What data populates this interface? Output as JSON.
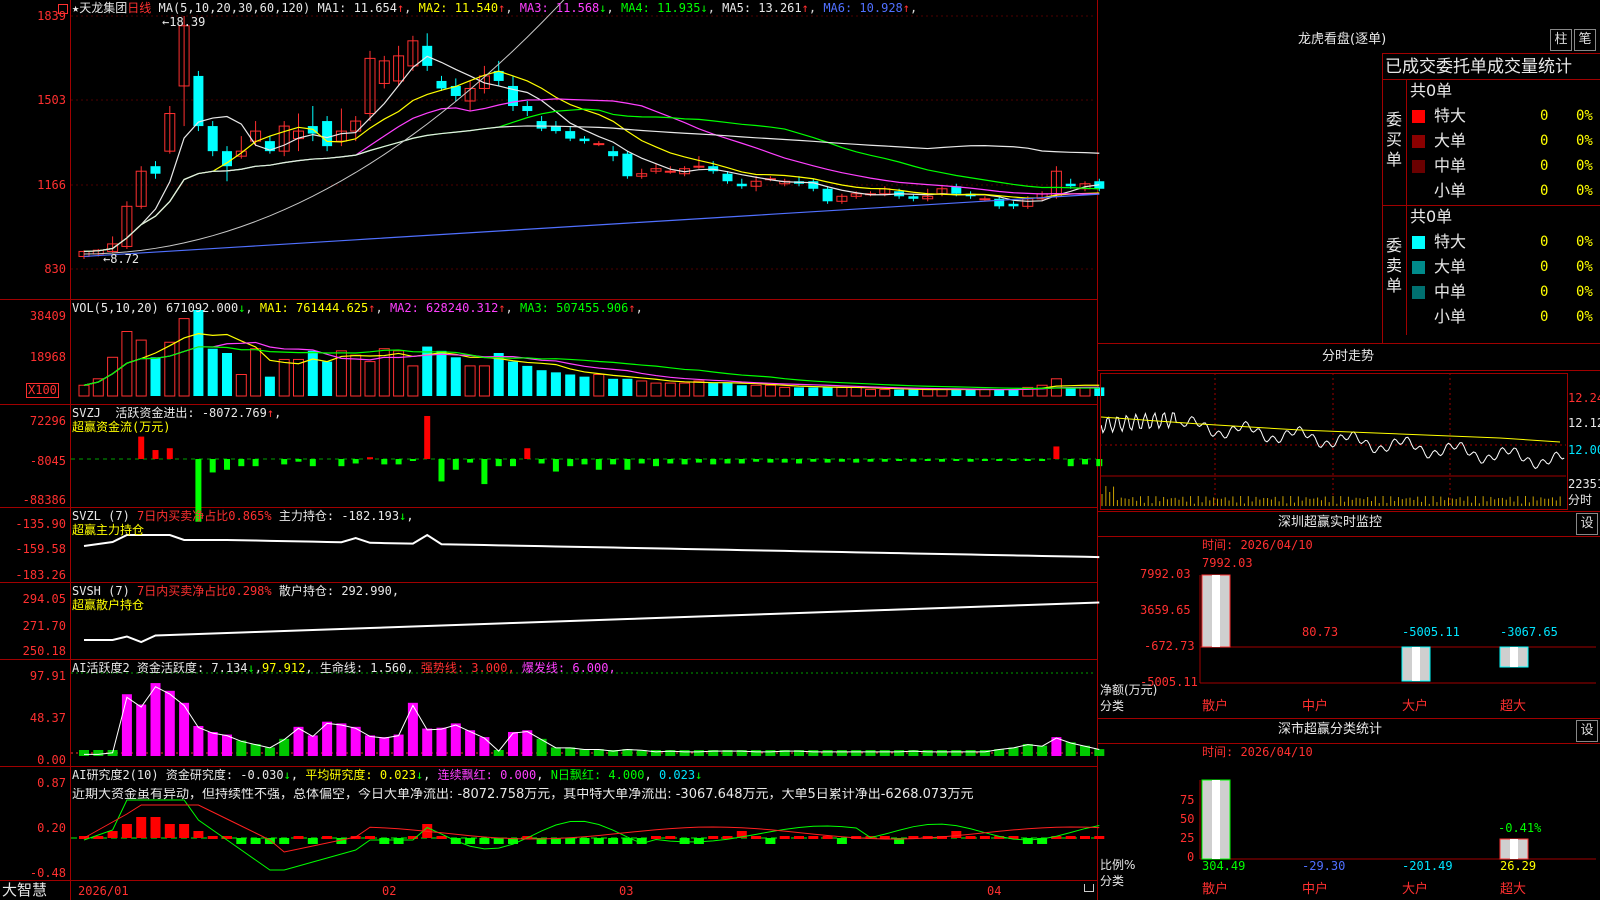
{
  "chart_data": {
    "type": "candlestick",
    "stock_name": "天龙集团",
    "period": "日线",
    "x_ticks": [
      "2026/01",
      "02",
      "03",
      "04"
    ],
    "price": {
      "axis": [
        "1839",
        "1503",
        "1166",
        "830"
      ],
      "ylim": [
        830,
        1839
      ],
      "max_label": "18.39",
      "min_label": "8.72",
      "ma_header": "MA(5,10,20,30,60,120)",
      "ma": [
        {
          "name": "MA1",
          "value": "11.654",
          "arrow": "↑",
          "color": "#e8e8e8"
        },
        {
          "name": "MA2",
          "value": "11.540",
          "arrow": "↑",
          "color": "#ffff00"
        },
        {
          "name": "MA3",
          "value": "11.568",
          "arrow": "↓",
          "color": "#ff40ff"
        },
        {
          "name": "MA4",
          "value": "11.935",
          "arrow": "↓",
          "color": "#00ff00"
        },
        {
          "name": "MA5",
          "value": "13.261",
          "arrow": "↑",
          "color": "#e8e8e8"
        },
        {
          "name": "MA6",
          "value": "10.928",
          "arrow": "↑",
          "color": "#5070ff"
        }
      ],
      "candles": [
        [
          880,
          900,
          870,
          905
        ],
        [
          890,
          905,
          880,
          910
        ],
        [
          900,
          930,
          895,
          960
        ],
        [
          920,
          1080,
          910,
          1100
        ],
        [
          1080,
          1220,
          1070,
          1240
        ],
        [
          1240,
          1210,
          1190,
          1260
        ],
        [
          1300,
          1450,
          1290,
          1480
        ],
        [
          1560,
          1800,
          1400,
          1839
        ],
        [
          1600,
          1400,
          1380,
          1620
        ],
        [
          1400,
          1300,
          1280,
          1420
        ],
        [
          1300,
          1240,
          1180,
          1320
        ],
        [
          1280,
          1300,
          1270,
          1360
        ],
        [
          1340,
          1380,
          1320,
          1420
        ],
        [
          1340,
          1300,
          1290,
          1360
        ],
        [
          1300,
          1400,
          1280,
          1420
        ],
        [
          1350,
          1380,
          1300,
          1450
        ],
        [
          1400,
          1370,
          1340,
          1480
        ],
        [
          1420,
          1320,
          1300,
          1440
        ],
        [
          1340,
          1380,
          1320,
          1470
        ],
        [
          1380,
          1420,
          1340,
          1440
        ],
        [
          1450,
          1670,
          1420,
          1700
        ],
        [
          1570,
          1660,
          1550,
          1680
        ],
        [
          1580,
          1680,
          1560,
          1720
        ],
        [
          1640,
          1740,
          1620,
          1760
        ],
        [
          1720,
          1640,
          1620,
          1770
        ],
        [
          1580,
          1550,
          1540,
          1600
        ],
        [
          1560,
          1520,
          1500,
          1590
        ],
        [
          1500,
          1550,
          1460,
          1580
        ],
        [
          1550,
          1600,
          1530,
          1640
        ],
        [
          1620,
          1580,
          1560,
          1660
        ],
        [
          1560,
          1480,
          1460,
          1600
        ],
        [
          1480,
          1460,
          1440,
          1500
        ],
        [
          1420,
          1390,
          1380,
          1440
        ],
        [
          1400,
          1380,
          1370,
          1420
        ],
        [
          1380,
          1350,
          1340,
          1400
        ],
        [
          1350,
          1340,
          1330,
          1360
        ],
        [
          1330,
          1330,
          1320,
          1340
        ],
        [
          1300,
          1280,
          1260,
          1320
        ],
        [
          1290,
          1200,
          1190,
          1300
        ],
        [
          1200,
          1210,
          1190,
          1230
        ],
        [
          1220,
          1230,
          1210,
          1250
        ],
        [
          1220,
          1220,
          1210,
          1240
        ],
        [
          1210,
          1230,
          1200,
          1240
        ],
        [
          1240,
          1240,
          1230,
          1280
        ],
        [
          1240,
          1220,
          1210,
          1260
        ],
        [
          1210,
          1180,
          1170,
          1220
        ],
        [
          1170,
          1160,
          1150,
          1190
        ],
        [
          1160,
          1180,
          1140,
          1200
        ],
        [
          1190,
          1190,
          1180,
          1200
        ],
        [
          1170,
          1180,
          1160,
          1190
        ],
        [
          1180,
          1170,
          1160,
          1200
        ],
        [
          1180,
          1150,
          1140,
          1190
        ],
        [
          1150,
          1100,
          1090,
          1160
        ],
        [
          1100,
          1120,
          1090,
          1130
        ],
        [
          1120,
          1130,
          1110,
          1140
        ],
        [
          1130,
          1130,
          1120,
          1140
        ],
        [
          1130,
          1150,
          1120,
          1160
        ],
        [
          1140,
          1120,
          1110,
          1150
        ],
        [
          1120,
          1110,
          1100,
          1130
        ],
        [
          1110,
          1120,
          1100,
          1150
        ],
        [
          1130,
          1150,
          1120,
          1160
        ],
        [
          1160,
          1130,
          1120,
          1170
        ],
        [
          1130,
          1120,
          1110,
          1140
        ],
        [
          1110,
          1110,
          1100,
          1120
        ],
        [
          1110,
          1080,
          1070,
          1120
        ],
        [
          1090,
          1080,
          1070,
          1100
        ],
        [
          1080,
          1110,
          1070,
          1120
        ],
        [
          1110,
          1130,
          1100,
          1140
        ],
        [
          1120,
          1220,
          1110,
          1240
        ],
        [
          1170,
          1160,
          1150,
          1190
        ],
        [
          1150,
          1170,
          1140,
          1180
        ],
        [
          1180,
          1150,
          1140,
          1190
        ]
      ]
    },
    "volume": {
      "header": "VOL(5,10,20)",
      "value": "671092.000",
      "value_arrow": "↓",
      "ma": [
        {
          "name": "MA1",
          "value": "761444.625",
          "arrow": "↑",
          "color": "#ffff00"
        },
        {
          "name": "MA2",
          "value": "628240.312",
          "arrow": "↑",
          "color": "#ff40ff"
        },
        {
          "name": "MA3",
          "value": "507455.906",
          "arrow": "↑",
          "color": "#00ff00"
        }
      ],
      "axis": [
        "38409",
        "18968"
      ],
      "unit": "X100",
      "ylim": [
        0,
        40000
      ],
      "values": [
        5,
        8,
        18,
        30,
        26,
        18,
        25,
        36,
        40,
        22,
        20,
        10,
        22,
        9,
        17,
        17,
        21,
        16,
        21,
        19,
        16,
        22,
        21,
        14,
        23,
        21,
        18,
        14,
        14,
        20,
        16,
        14,
        12,
        11,
        10,
        9,
        10,
        8,
        8,
        7,
        6,
        6,
        6,
        7,
        6,
        6,
        5,
        5,
        5,
        4,
        4,
        4,
        4,
        4,
        4,
        3,
        3,
        3,
        3,
        3,
        3,
        3,
        3,
        3,
        3,
        3,
        4,
        5,
        8,
        4,
        4,
        4
      ]
    },
    "svzj": {
      "header": "SVZJ",
      "name": "活跃资金进出",
      "value": "-8072.769",
      "value_arrow": "↑",
      "subtitle": "超赢资金流(万元)",
      "axis": [
        "72296",
        "-8045",
        "-88386"
      ],
      "ylim": [
        -88386,
        72296
      ],
      "values": [
        0,
        0,
        0,
        0,
        25000,
        10000,
        12000,
        0,
        -70000,
        -15000,
        -12000,
        -8000,
        -8000,
        0,
        -6000,
        -3000,
        -8000,
        0,
        -8000,
        -5000,
        2000,
        -6000,
        -6000,
        -2000,
        48000,
        -25000,
        -12000,
        -4000,
        -28000,
        -8000,
        -8000,
        12000,
        -5000,
        -14000,
        -8000,
        -6000,
        -12000,
        -6000,
        -12000,
        -5000,
        -8000,
        -5000,
        -6000,
        -4000,
        -6000,
        -5000,
        -5000,
        -3000,
        -4000,
        -4000,
        -5000,
        -3000,
        -4000,
        -3000,
        -4000,
        -3000,
        -3000,
        -2000,
        -3000,
        -2000,
        -3000,
        -2000,
        -3000,
        -2000,
        -2000,
        -2000,
        -2000,
        -2000,
        14000,
        -8000,
        -6000,
        -8000
      ]
    },
    "svzl": {
      "header": "SVZL (7)",
      "name": "7日内买卖净占比",
      "ratio": "0.865%",
      "holding_name": "主力持仓",
      "holding": "-182.193",
      "holding_arrow": "↓",
      "subtitle": "超赢主力持仓",
      "axis": [
        "-135.90",
        "-159.58",
        "-183.26"
      ],
      "ylim": [
        -183.26,
        -135.9
      ]
    },
    "svsh": {
      "header": "SVSH (7)",
      "name": "7日内买卖净占比",
      "ratio": "0.298%",
      "holding_name": "散户持仓",
      "holding": "292.990",
      "subtitle": "超赢散户持仓",
      "axis": [
        "294.05",
        "271.70",
        "250.18"
      ],
      "ylim": [
        250.18,
        294.05
      ]
    },
    "ai_active": {
      "header": "AI活跃度2",
      "name": "资金活跃度",
      "value": "7.134",
      "value_arrow": "↓",
      "value2": "97.912",
      "life_line": "生命线: 1.560",
      "strong_line": "强势线: 3.000",
      "burst_line": "爆发线: 6.000",
      "axis": [
        "97.91",
        "48.37",
        "0.00"
      ],
      "ylim": [
        0,
        97.91
      ],
      "values": [
        2,
        2,
        4,
        72,
        60,
        85,
        76,
        62,
        35,
        28,
        25,
        18,
        14,
        10,
        20,
        34,
        24,
        40,
        38,
        34,
        24,
        22,
        25,
        62,
        32,
        33,
        38,
        30,
        22,
        6,
        28,
        30,
        20,
        10,
        10,
        8,
        8,
        6,
        8,
        7,
        5,
        6,
        5,
        5,
        6,
        6,
        6,
        5,
        5,
        6,
        6,
        5,
        5,
        5,
        5,
        5,
        5,
        5,
        6,
        5,
        5,
        5,
        5,
        5,
        8,
        10,
        14,
        12,
        22,
        16,
        12,
        8
      ]
    },
    "ai_research": {
      "header": "AI研究度2(10)",
      "name": "资金研究度",
      "value": "-0.030",
      "avg_name": "平均研究度",
      "avg": "0.023",
      "red_name": "连续飘红",
      "red": "0.000",
      "nday_name": "N日飘红",
      "nday": "4.000",
      "last": "0.023",
      "axis": [
        "0.87",
        "0.20",
        "-0.48"
      ],
      "ylim": [
        -0.48,
        0.87
      ],
      "comment": "近期大资金虽有异动，但持续性不强，总体偏空，今日大单净流出: -8072.758万元，其中特大单净流出: -3067.648万元，大单5日累计净出-6268.073万元"
    }
  },
  "logo": "大智慧",
  "panel": {
    "title": "龙虎看盘(逐单)",
    "buttons": [
      "柱",
      "笔"
    ],
    "section_title": "已成交委托单成交量统计",
    "buy_label": "委买单",
    "sell_label": "委卖单",
    "buy_total": "共0单",
    "sell_total": "共0单",
    "rows": [
      {
        "name": "特大",
        "count": "0",
        "pct": "0%"
      },
      {
        "name": "大单",
        "count": "0",
        "pct": "0%"
      },
      {
        "name": "中单",
        "count": "0",
        "pct": "0%"
      },
      {
        "name": "小单",
        "count": "0",
        "pct": "0%"
      }
    ],
    "buy_colors": [
      "#ff0000",
      "#8b0000",
      "#6a0000",
      "#000000"
    ],
    "sell_colors": [
      "#00ffff",
      "#008b8b",
      "#007070",
      "#000000"
    ]
  },
  "intraday": {
    "title": "分时走势",
    "axis": [
      "12.24",
      "12.12",
      "12.00"
    ],
    "vol_label": "22351",
    "unit": "分时"
  },
  "sz_monitor": {
    "title": "深圳超赢实时监控",
    "setting": "设",
    "time": "时间: 2026/04/10",
    "axis": [
      "7992.03",
      "3659.65",
      "-672.73",
      "-5005.11"
    ],
    "ylabel": "净额(万元)",
    "xlabel": "分类",
    "categories": [
      "散户",
      "中户",
      "大户",
      "超大"
    ],
    "values": [
      "7992.03",
      "80.73",
      "-5005.11",
      "-3067.65"
    ]
  },
  "sz_class": {
    "title": "深市超赢分类统计",
    "setting": "设",
    "time": "时间: 2026/04/10",
    "axis": [
      "75",
      "50",
      "25",
      "0"
    ],
    "ylabel": "比例%",
    "xlabel": "分类",
    "categories": [
      "散户",
      "中户",
      "大户",
      "超大"
    ],
    "values": [
      "304.49",
      "-29.30",
      "-201.49",
      "26.29"
    ],
    "extra_label": "-0.41%"
  }
}
